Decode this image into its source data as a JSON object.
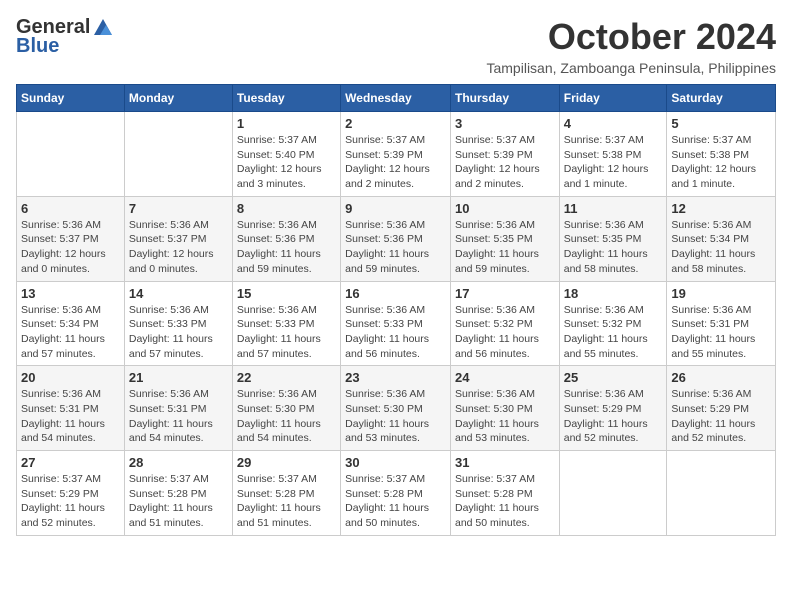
{
  "header": {
    "logo_general": "General",
    "logo_blue": "Blue",
    "month_title": "October 2024",
    "location": "Tampilisan, Zamboanga Peninsula, Philippines"
  },
  "weekdays": [
    "Sunday",
    "Monday",
    "Tuesday",
    "Wednesday",
    "Thursday",
    "Friday",
    "Saturday"
  ],
  "weeks": [
    [
      {
        "day": "",
        "info": ""
      },
      {
        "day": "",
        "info": ""
      },
      {
        "day": "1",
        "info": "Sunrise: 5:37 AM\nSunset: 5:40 PM\nDaylight: 12 hours\nand 3 minutes."
      },
      {
        "day": "2",
        "info": "Sunrise: 5:37 AM\nSunset: 5:39 PM\nDaylight: 12 hours\nand 2 minutes."
      },
      {
        "day": "3",
        "info": "Sunrise: 5:37 AM\nSunset: 5:39 PM\nDaylight: 12 hours\nand 2 minutes."
      },
      {
        "day": "4",
        "info": "Sunrise: 5:37 AM\nSunset: 5:38 PM\nDaylight: 12 hours\nand 1 minute."
      },
      {
        "day": "5",
        "info": "Sunrise: 5:37 AM\nSunset: 5:38 PM\nDaylight: 12 hours\nand 1 minute."
      }
    ],
    [
      {
        "day": "6",
        "info": "Sunrise: 5:36 AM\nSunset: 5:37 PM\nDaylight: 12 hours\nand 0 minutes."
      },
      {
        "day": "7",
        "info": "Sunrise: 5:36 AM\nSunset: 5:37 PM\nDaylight: 12 hours\nand 0 minutes."
      },
      {
        "day": "8",
        "info": "Sunrise: 5:36 AM\nSunset: 5:36 PM\nDaylight: 11 hours\nand 59 minutes."
      },
      {
        "day": "9",
        "info": "Sunrise: 5:36 AM\nSunset: 5:36 PM\nDaylight: 11 hours\nand 59 minutes."
      },
      {
        "day": "10",
        "info": "Sunrise: 5:36 AM\nSunset: 5:35 PM\nDaylight: 11 hours\nand 59 minutes."
      },
      {
        "day": "11",
        "info": "Sunrise: 5:36 AM\nSunset: 5:35 PM\nDaylight: 11 hours\nand 58 minutes."
      },
      {
        "day": "12",
        "info": "Sunrise: 5:36 AM\nSunset: 5:34 PM\nDaylight: 11 hours\nand 58 minutes."
      }
    ],
    [
      {
        "day": "13",
        "info": "Sunrise: 5:36 AM\nSunset: 5:34 PM\nDaylight: 11 hours\nand 57 minutes."
      },
      {
        "day": "14",
        "info": "Sunrise: 5:36 AM\nSunset: 5:33 PM\nDaylight: 11 hours\nand 57 minutes."
      },
      {
        "day": "15",
        "info": "Sunrise: 5:36 AM\nSunset: 5:33 PM\nDaylight: 11 hours\nand 57 minutes."
      },
      {
        "day": "16",
        "info": "Sunrise: 5:36 AM\nSunset: 5:33 PM\nDaylight: 11 hours\nand 56 minutes."
      },
      {
        "day": "17",
        "info": "Sunrise: 5:36 AM\nSunset: 5:32 PM\nDaylight: 11 hours\nand 56 minutes."
      },
      {
        "day": "18",
        "info": "Sunrise: 5:36 AM\nSunset: 5:32 PM\nDaylight: 11 hours\nand 55 minutes."
      },
      {
        "day": "19",
        "info": "Sunrise: 5:36 AM\nSunset: 5:31 PM\nDaylight: 11 hours\nand 55 minutes."
      }
    ],
    [
      {
        "day": "20",
        "info": "Sunrise: 5:36 AM\nSunset: 5:31 PM\nDaylight: 11 hours\nand 54 minutes."
      },
      {
        "day": "21",
        "info": "Sunrise: 5:36 AM\nSunset: 5:31 PM\nDaylight: 11 hours\nand 54 minutes."
      },
      {
        "day": "22",
        "info": "Sunrise: 5:36 AM\nSunset: 5:30 PM\nDaylight: 11 hours\nand 54 minutes."
      },
      {
        "day": "23",
        "info": "Sunrise: 5:36 AM\nSunset: 5:30 PM\nDaylight: 11 hours\nand 53 minutes."
      },
      {
        "day": "24",
        "info": "Sunrise: 5:36 AM\nSunset: 5:30 PM\nDaylight: 11 hours\nand 53 minutes."
      },
      {
        "day": "25",
        "info": "Sunrise: 5:36 AM\nSunset: 5:29 PM\nDaylight: 11 hours\nand 52 minutes."
      },
      {
        "day": "26",
        "info": "Sunrise: 5:36 AM\nSunset: 5:29 PM\nDaylight: 11 hours\nand 52 minutes."
      }
    ],
    [
      {
        "day": "27",
        "info": "Sunrise: 5:37 AM\nSunset: 5:29 PM\nDaylight: 11 hours\nand 52 minutes."
      },
      {
        "day": "28",
        "info": "Sunrise: 5:37 AM\nSunset: 5:28 PM\nDaylight: 11 hours\nand 51 minutes."
      },
      {
        "day": "29",
        "info": "Sunrise: 5:37 AM\nSunset: 5:28 PM\nDaylight: 11 hours\nand 51 minutes."
      },
      {
        "day": "30",
        "info": "Sunrise: 5:37 AM\nSunset: 5:28 PM\nDaylight: 11 hours\nand 50 minutes."
      },
      {
        "day": "31",
        "info": "Sunrise: 5:37 AM\nSunset: 5:28 PM\nDaylight: 11 hours\nand 50 minutes."
      },
      {
        "day": "",
        "info": ""
      },
      {
        "day": "",
        "info": ""
      }
    ]
  ]
}
